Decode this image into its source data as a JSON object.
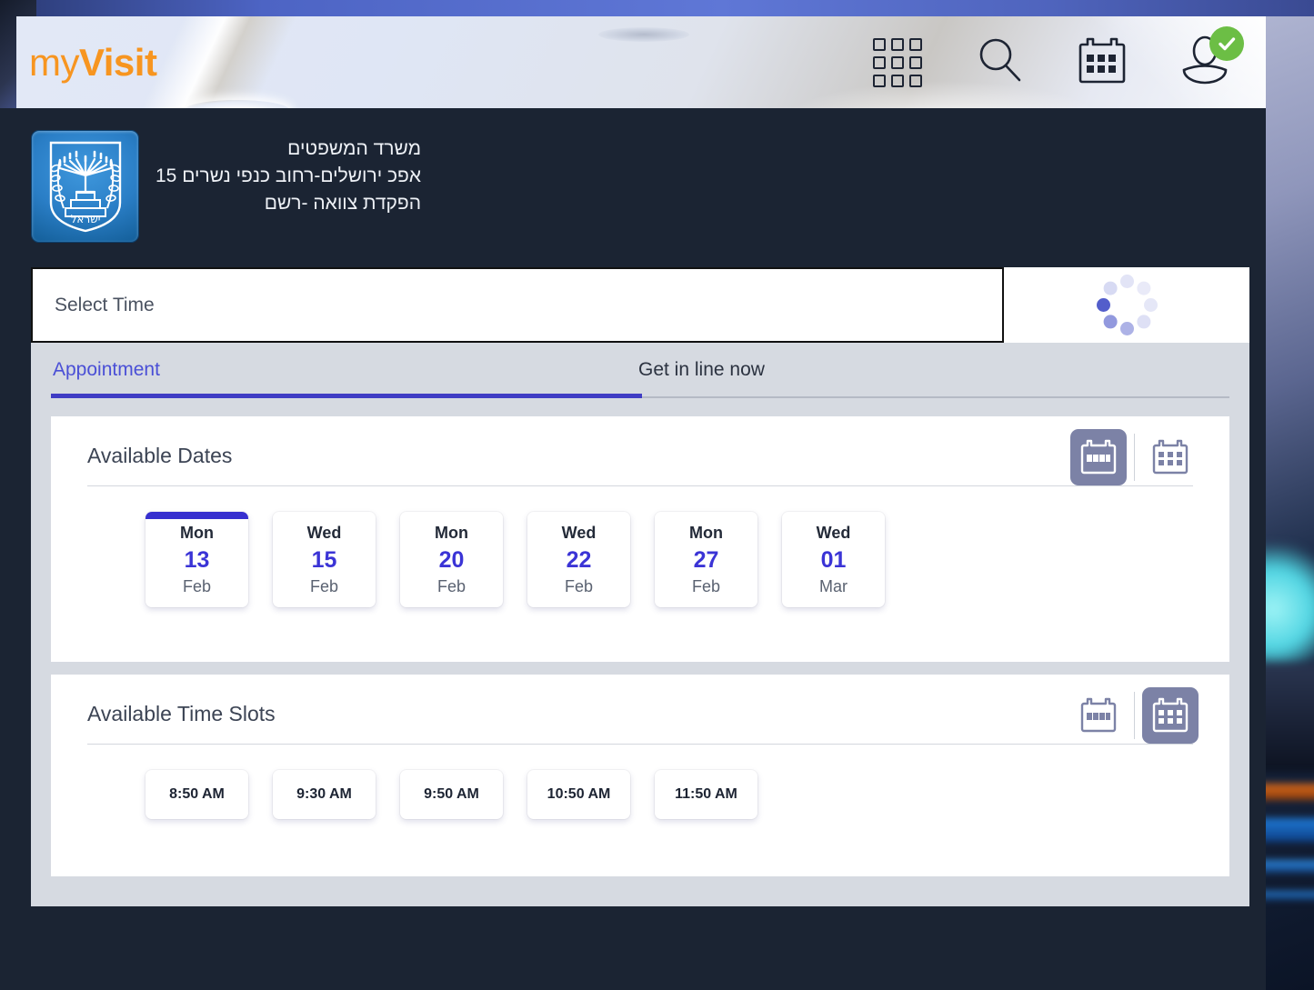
{
  "brand": {
    "logo_prefix": "my",
    "logo_suffix": "Visit"
  },
  "header": {
    "icons": [
      {
        "name": "apps-grid-icon",
        "label": "apps"
      },
      {
        "name": "search-icon",
        "label": "search"
      },
      {
        "name": "calendar-icon",
        "label": "calendar"
      },
      {
        "name": "user-avatar-icon",
        "label": "account"
      }
    ],
    "avatar_badge": "verified-check"
  },
  "office": {
    "name": "משרד המשפטים",
    "address": "אפכ ירושלים-רחוב כנפי נשרים 15",
    "service": "הפקדת צוואה -רשם",
    "emblem_label": "israel-state-emblem",
    "emblem_text": "ישראל"
  },
  "select_bar": {
    "label": "Select Time",
    "loading": true
  },
  "tabs": [
    {
      "label": "Appointment",
      "active": true
    },
    {
      "label": "Get in line now",
      "active": false
    }
  ],
  "dates_section": {
    "title": "Available Dates",
    "view_modes": [
      {
        "name": "week-view-icon",
        "active": true
      },
      {
        "name": "month-grid-view-icon",
        "active": false
      }
    ],
    "dates": [
      {
        "dow": "Mon",
        "day": "13",
        "month": "Feb",
        "selected": true
      },
      {
        "dow": "Wed",
        "day": "15",
        "month": "Feb",
        "selected": false
      },
      {
        "dow": "Mon",
        "day": "20",
        "month": "Feb",
        "selected": false
      },
      {
        "dow": "Wed",
        "day": "22",
        "month": "Feb",
        "selected": false
      },
      {
        "dow": "Mon",
        "day": "27",
        "month": "Feb",
        "selected": false
      },
      {
        "dow": "Wed",
        "day": "01",
        "month": "Mar",
        "selected": false
      }
    ]
  },
  "slots_section": {
    "title": "Available Time Slots",
    "view_modes": [
      {
        "name": "week-view-icon",
        "active": false
      },
      {
        "name": "month-grid-view-icon",
        "active": true
      }
    ],
    "slots": [
      {
        "time": "8:50 AM"
      },
      {
        "time": "9:30 AM"
      },
      {
        "time": "9:50 AM"
      },
      {
        "time": "10:50 AM"
      },
      {
        "time": "11:50 AM"
      }
    ]
  },
  "colors": {
    "brand_orange": "#f79520",
    "accent_indigo": "#3730cf",
    "tab_active": "#4a4fd6",
    "dark_navy": "#1b2433",
    "panel_gray": "#d6dae1",
    "badge_green": "#6cbe45",
    "toggle_active": "#7c82a6"
  }
}
